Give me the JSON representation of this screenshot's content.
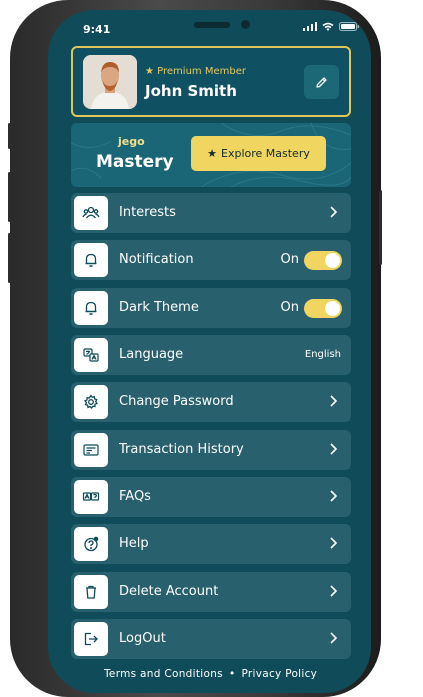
{
  "status_bar": {
    "time": "9:41"
  },
  "profile": {
    "badge": "Premium Member",
    "name": "John Smith"
  },
  "mastery": {
    "brand": "jego",
    "title": "Mastery",
    "cta": "Explore Mastery"
  },
  "menu": [
    {
      "label": "Interests"
    },
    {
      "label": "Notification",
      "state": "On"
    },
    {
      "label": "Dark Theme",
      "state": "On"
    },
    {
      "label": "Language",
      "value": "English"
    },
    {
      "label": "Change Password"
    },
    {
      "label": "Transaction History"
    },
    {
      "label": "FAQs"
    },
    {
      "label": "Help"
    },
    {
      "label": "Delete Account"
    },
    {
      "label": "LogOut"
    }
  ],
  "footer": {
    "terms": "Terms and Conditions",
    "separator": "•",
    "privacy": "Privacy Policy"
  },
  "colors": {
    "screen_bg": "#0f4b59",
    "item_bg": "#29606e",
    "accent": "#f0d660"
  }
}
